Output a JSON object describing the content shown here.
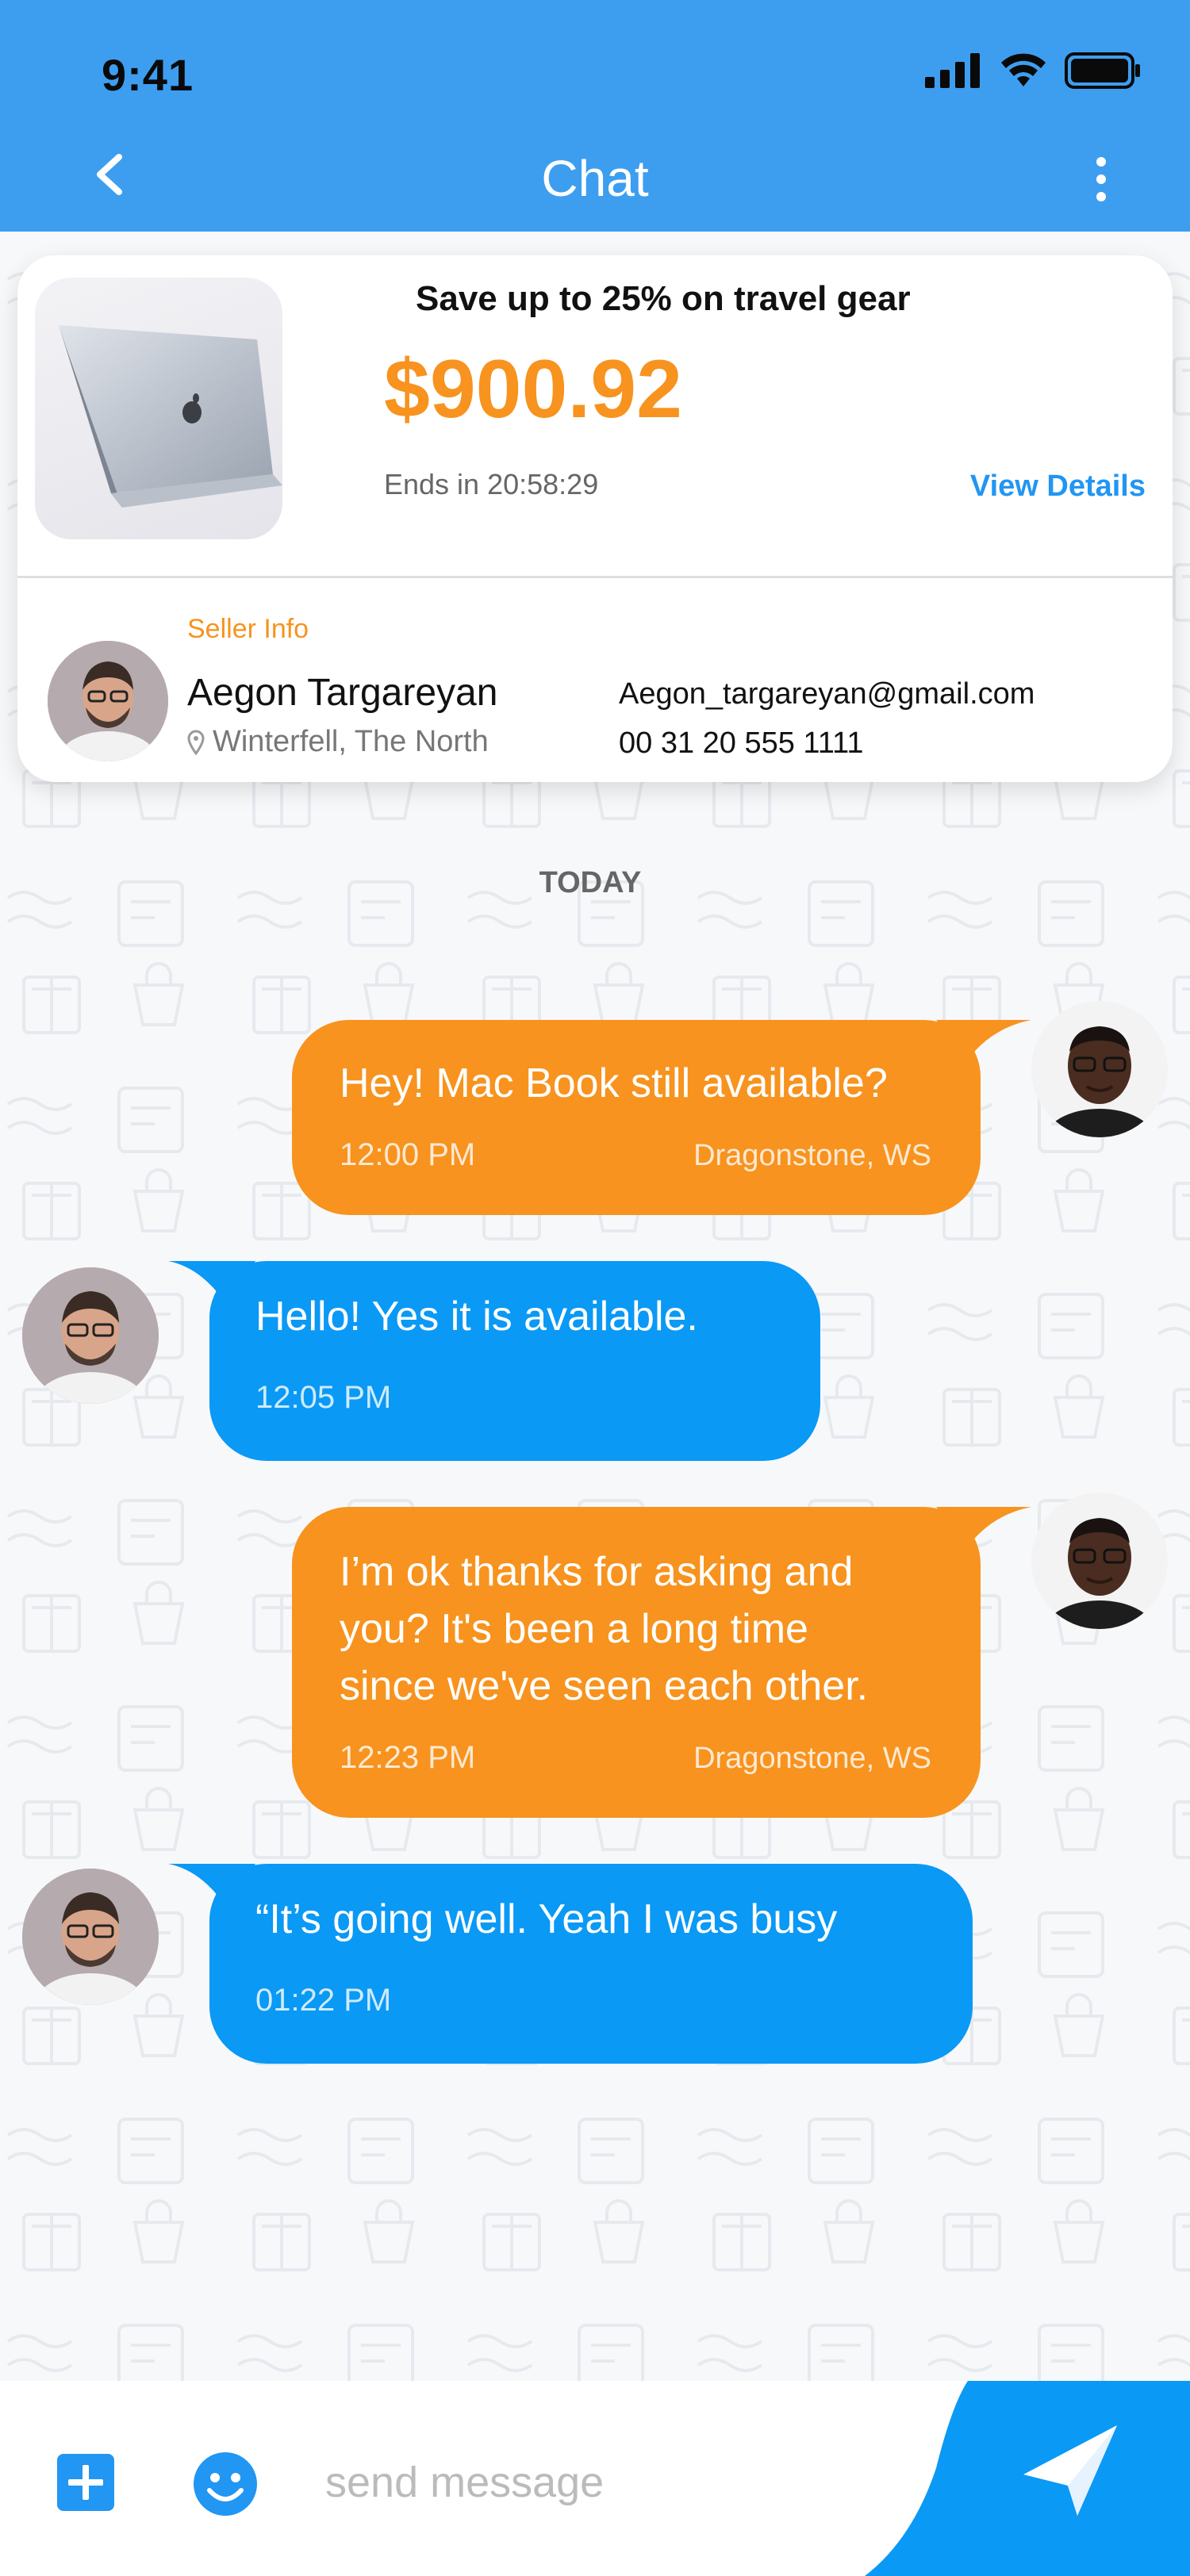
{
  "status": {
    "time": "9:41"
  },
  "header": {
    "title": "Chat",
    "back_icon": "chevron-left-icon",
    "more_icon": "more-vertical-icon",
    "color": "#3d9ef0"
  },
  "deal": {
    "headline": "Save up to 25% on travel gear",
    "price": "$900.92",
    "ends": "Ends in 20:58:29",
    "view_details": "View Details",
    "image": "laptop"
  },
  "seller": {
    "label": "Seller Info",
    "name": "Aegon Targareyan",
    "location": "Winterfell, The North",
    "email": "Aegon_targareyan@gmail.com",
    "phone": "00 31 20 555 1111"
  },
  "day_label": "TODAY",
  "messages": [
    {
      "direction": "out",
      "text": [
        "Hey! Mac Book still available?"
      ],
      "time": "12:00 PM",
      "location": "Dragonstone, WS"
    },
    {
      "direction": "in",
      "text": [
        "Hello! Yes it is available."
      ],
      "time": "12:05 PM"
    },
    {
      "direction": "out",
      "text": [
        "I’m ok thanks for asking and",
        "you? It's been a long time",
        "since we've seen each other."
      ],
      "time": "12:23 PM",
      "location": "Dragonstone, WS"
    },
    {
      "direction": "in",
      "text": [
        "“It’s going well. Yeah I was busy"
      ],
      "time": "01:22 PM"
    }
  ],
  "composer": {
    "placeholder": "send message",
    "plus_icon": "plus-icon",
    "emoji_icon": "smiley-icon",
    "send_icon": "send-icon"
  },
  "colors": {
    "outgoing": "#f7931e",
    "incoming": "#0a99f5",
    "accent": "#2196f3"
  }
}
